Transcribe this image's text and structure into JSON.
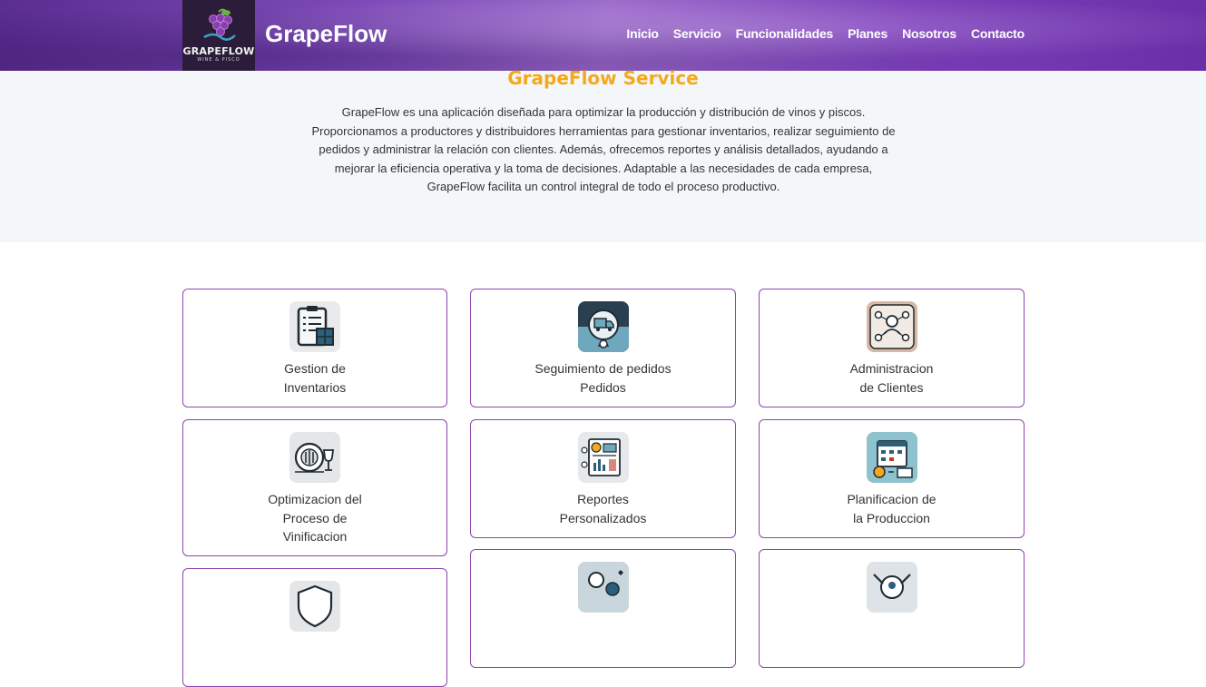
{
  "header": {
    "logo_text": "GRAPEFLOW",
    "logo_sub": "WINE & PISCO",
    "brand": "GrapeFlow",
    "nav": [
      "Inicio",
      "Servicio",
      "Funcionalidades",
      "Planes",
      "Nosotros",
      "Contacto"
    ]
  },
  "intro": {
    "title": "GrapeFlow Service",
    "text": "GrapeFlow es una aplicación diseñada para optimizar la producción y distribución de vinos y piscos. Proporcionamos a productores y distribuidores herramientas para gestionar inventarios, realizar seguimiento de pedidos y administrar la relación con clientes. Además, ofrecemos reportes y análisis detallados, ayudando a mejorar la eficiencia operativa y la toma de decisiones. Adaptable a las necesidades de cada empresa, GrapeFlow facilita un control integral de todo el proceso productivo."
  },
  "cards": [
    {
      "line1": "Gestion de",
      "line2": "Inventarios",
      "line3": "",
      "icon": "inventory-clipboard-icon"
    },
    {
      "line1": "Seguimiento de pedidos",
      "line2": "Pedidos",
      "line3": "",
      "icon": "delivery-truck-icon"
    },
    {
      "line1": "Administracion",
      "line2": "de Clientes",
      "line3": "",
      "icon": "clients-network-icon"
    },
    {
      "line1": "Optimizacion del",
      "line2": "Proceso de",
      "line3": "Vinificacion",
      "icon": "wine-barrel-icon"
    },
    {
      "line1": "Reportes",
      "line2": "Personalizados",
      "line3": "",
      "icon": "reports-dashboard-icon"
    },
    {
      "line1": "Planificacion de",
      "line2": "la Produccion",
      "line3": "",
      "icon": "production-calendar-icon"
    },
    {
      "icon": "shield-icon"
    },
    {
      "icon": "settings-gears-icon"
    },
    {
      "icon": "support-tools-icon"
    }
  ],
  "colors": {
    "accent": "#f5a81c",
    "card_border": "#8e44ad",
    "header_purple": "#7d4bb8"
  }
}
